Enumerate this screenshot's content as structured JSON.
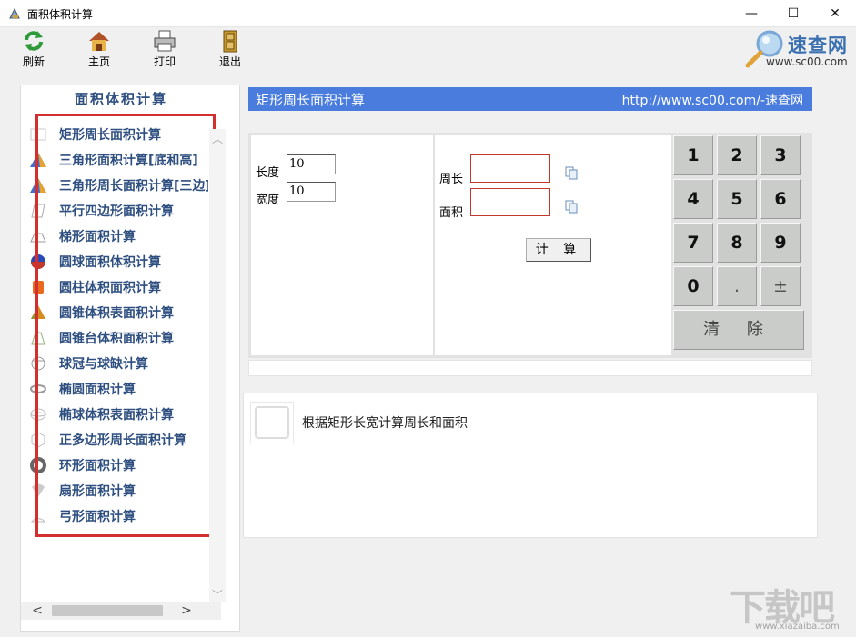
{
  "window": {
    "title": "面积体积计算",
    "minimize_glyph": "—",
    "maximize_glyph": "☐",
    "close_glyph": "✕"
  },
  "toolbar": {
    "refresh_label": "刷新",
    "home_label": "主页",
    "print_label": "打印",
    "exit_label": "退出"
  },
  "logo": {
    "name": "速查网",
    "url": "www.sc00.com"
  },
  "sidebar": {
    "title": "面积体积计算",
    "items": [
      {
        "label": "矩形周长面积计算",
        "icon": "rectangle-icon"
      },
      {
        "label": "三角形面积计算[底和高]",
        "icon": "triangle-icon"
      },
      {
        "label": "三角形周长面积计算[三边]",
        "icon": "triangle-icon"
      },
      {
        "label": "平行四边形面积计算",
        "icon": "parallelogram-icon"
      },
      {
        "label": "梯形面积计算",
        "icon": "trapezoid-icon"
      },
      {
        "label": "圆球面积体积计算",
        "icon": "sphere-icon"
      },
      {
        "label": "圆柱体积面积计算",
        "icon": "cylinder-icon"
      },
      {
        "label": "圆锥体积表面积计算",
        "icon": "cone-icon"
      },
      {
        "label": "圆锥台体积面积计算",
        "icon": "frustum-icon"
      },
      {
        "label": "球冠与球缺计算",
        "icon": "spherical-cap-icon"
      },
      {
        "label": "椭圆面积计算",
        "icon": "ellipse-icon"
      },
      {
        "label": "椭球体积表面积计算",
        "icon": "ellipsoid-icon"
      },
      {
        "label": "正多边形周长面积计算",
        "icon": "polygon-icon"
      },
      {
        "label": "环形面积计算",
        "icon": "ring-icon"
      },
      {
        "label": "扇形面积计算",
        "icon": "sector-icon"
      },
      {
        "label": "弓形面积计算",
        "icon": "segment-icon"
      }
    ],
    "scroll_up": "︿",
    "scroll_down": "﹀",
    "scroll_left": "<",
    "scroll_right": ">"
  },
  "content": {
    "title": "矩形周长面积计算",
    "url": "http://www.sc00.com/-速查网",
    "length_label": "长度",
    "length_value": "10",
    "width_label": "宽度",
    "width_value": "10",
    "perimeter_label": "周长",
    "perimeter_value": "",
    "area_label": "面积",
    "area_value": "",
    "calc_button": "计 算",
    "description": "根据矩形长宽计算周长和面积"
  },
  "keypad": {
    "keys": [
      "1",
      "2",
      "3",
      "4",
      "5",
      "6",
      "7",
      "8",
      "9",
      "0",
      ".",
      "±"
    ],
    "clear": "清 除"
  },
  "watermark": {
    "text": "下载吧",
    "url": "www.xiazaiba.com"
  },
  "colors": {
    "header_blue": "#4a7cdd",
    "nav_text": "#2e4f80",
    "highlight_red": "#d32f2f",
    "result_border": "#c0392b",
    "key_face": "#c9ccc9"
  }
}
